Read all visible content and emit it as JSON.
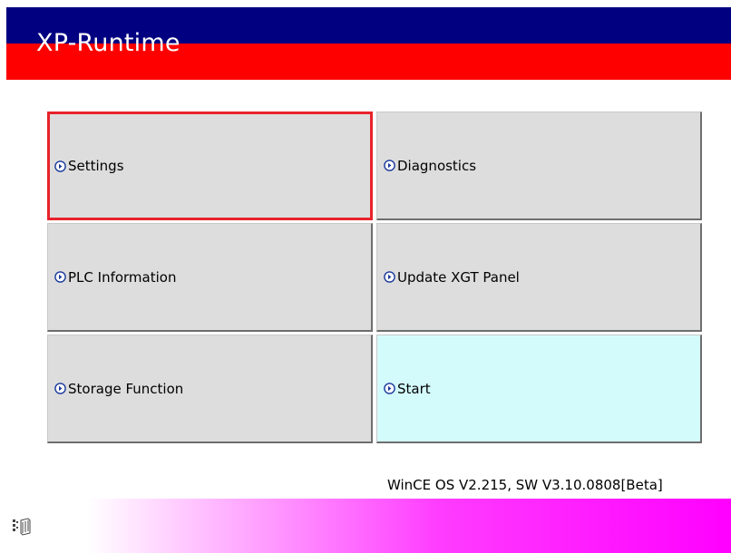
{
  "app": {
    "title": "XP-Runtime"
  },
  "menu": {
    "items": [
      {
        "label": "Settings",
        "icon": "circle-arrow-right-icon"
      },
      {
        "label": "Diagnostics",
        "icon": "circle-arrow-right-icon"
      },
      {
        "label": "PLC Information",
        "icon": "circle-arrow-right-icon"
      },
      {
        "label": "Update XGT Panel",
        "icon": "circle-arrow-right-icon"
      },
      {
        "label": "Storage Function",
        "icon": "circle-arrow-right-icon"
      },
      {
        "label": "Start",
        "icon": "circle-arrow-right-icon"
      }
    ],
    "selected": "Settings"
  },
  "status": {
    "version": "WinCE OS V2.215, SW V3.10.0808[Beta]"
  },
  "footer": {
    "icon": "keyboard-icon"
  },
  "colors": {
    "header_top": "#000080",
    "header_bottom": "#ff0000",
    "button_face": "#dddddd",
    "start_button_face": "#d4fbfc",
    "selected_border": "#e8222b",
    "footer_gradient_end": "#ff00ff"
  }
}
